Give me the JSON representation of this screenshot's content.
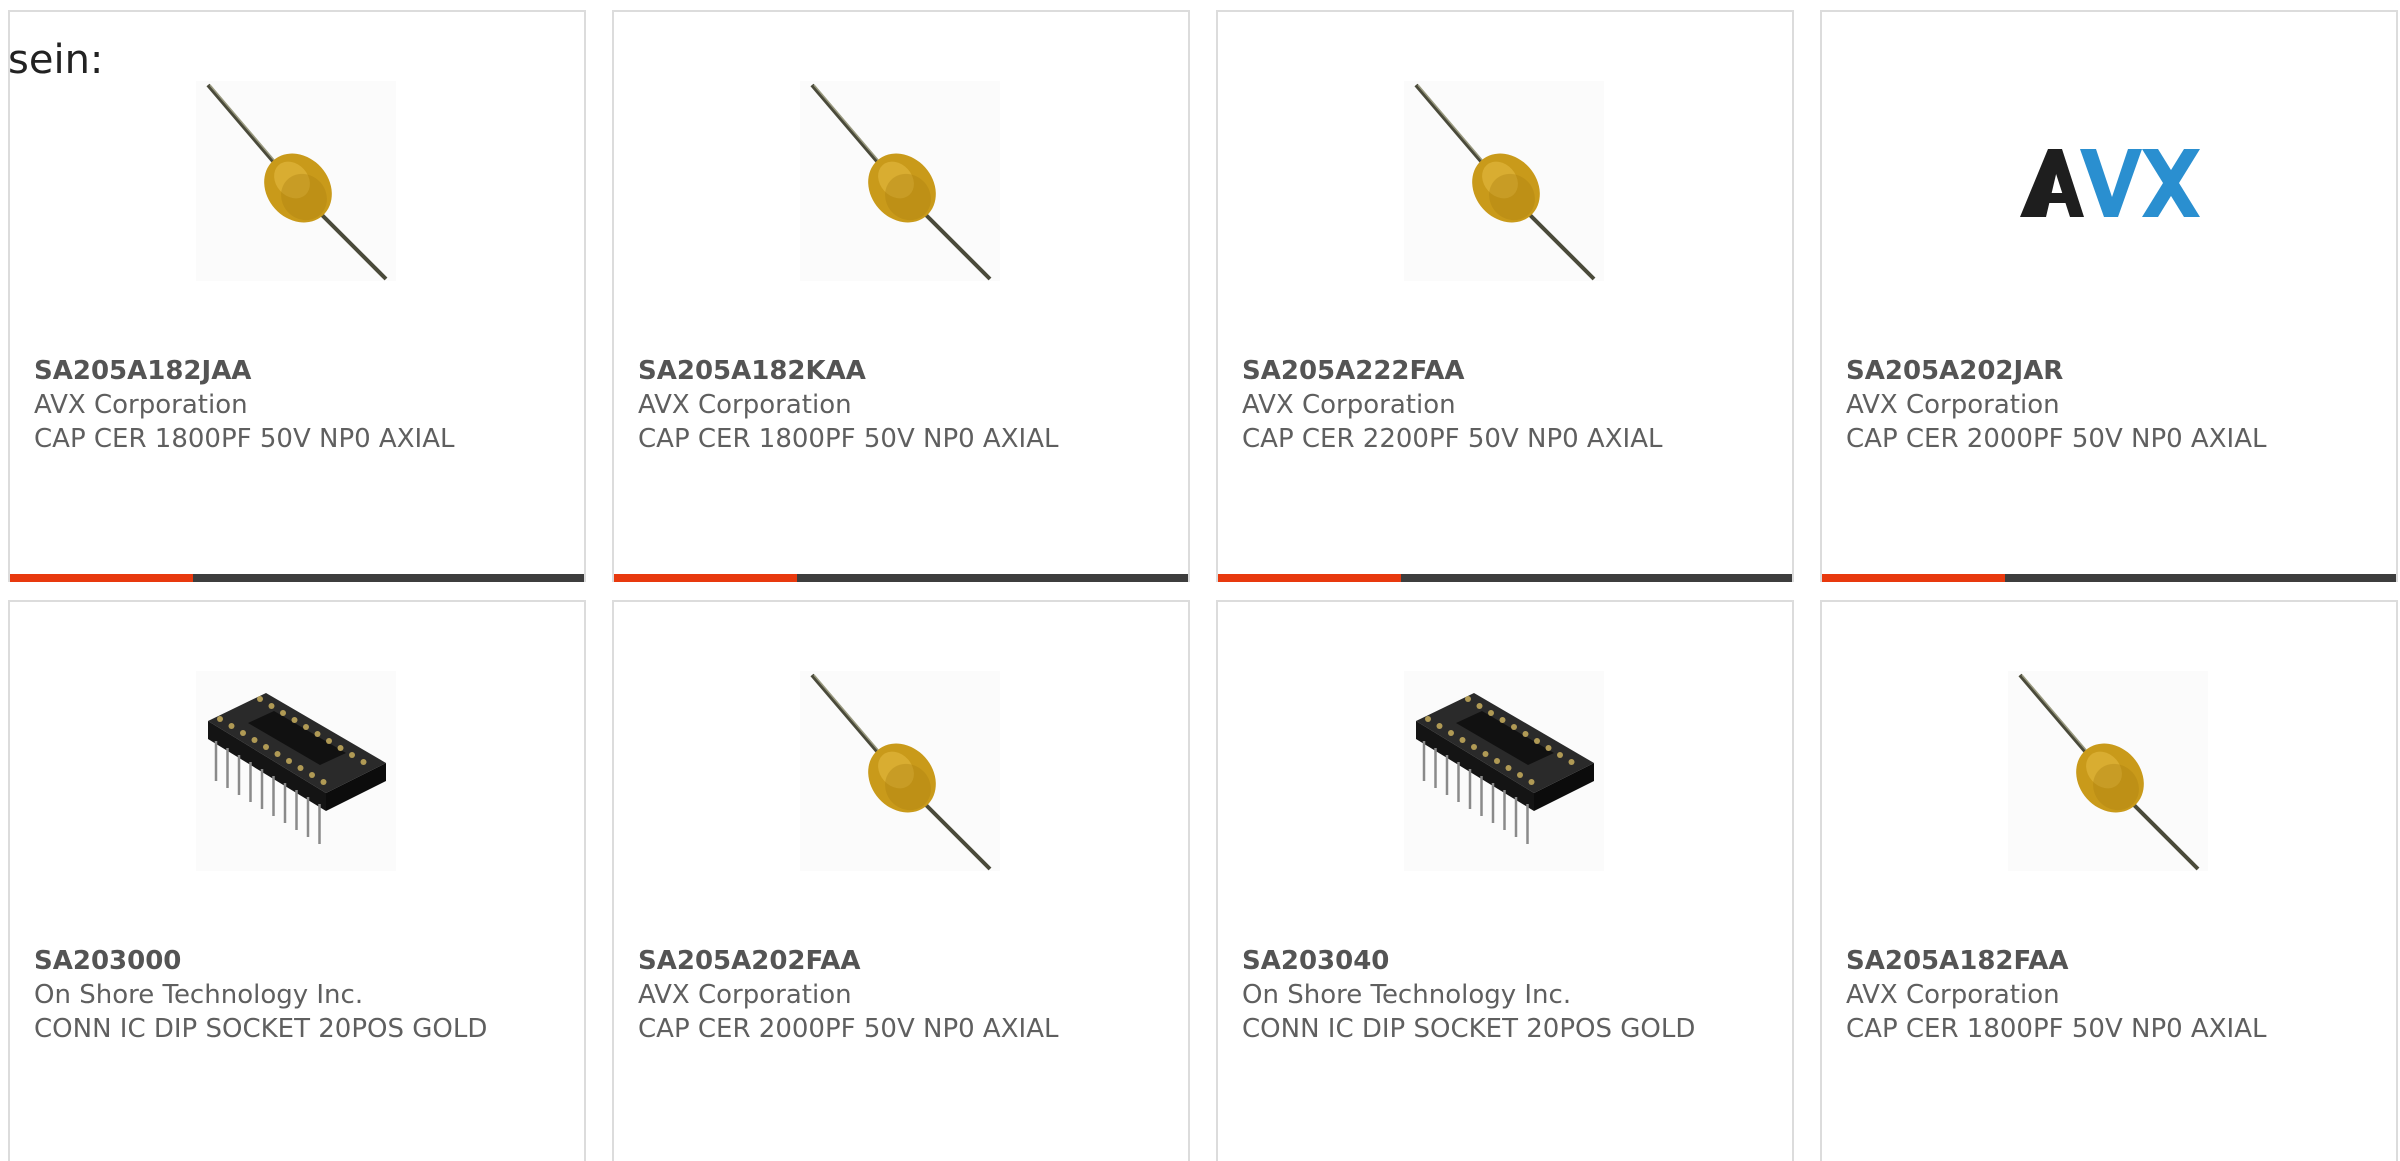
{
  "intro_text": "sein:",
  "colors": {
    "accent": "#e8390e",
    "bar": "#3d3d3d",
    "border": "#dcdcdc",
    "text": "#5f5f5f"
  },
  "products": [
    {
      "part_number": "SA205A182JAA",
      "manufacturer": "AVX Corporation",
      "description": "CAP CER 1800PF 50V NP0 AXIAL",
      "image": "axial-capacitor-icon"
    },
    {
      "part_number": "SA205A182KAA",
      "manufacturer": "AVX Corporation",
      "description": "CAP CER 1800PF 50V NP0 AXIAL",
      "image": "axial-capacitor-icon"
    },
    {
      "part_number": "SA205A222FAA",
      "manufacturer": "AVX Corporation",
      "description": "CAP CER 2200PF 50V NP0 AXIAL",
      "image": "axial-capacitor-icon"
    },
    {
      "part_number": "SA205A202JAR",
      "manufacturer": "AVX Corporation",
      "description": "CAP CER 2000PF 50V NP0 AXIAL",
      "image": "avx-logo",
      "logo_text": "AVX"
    },
    {
      "part_number": "SA203000",
      "manufacturer": "On Shore Technology Inc.",
      "description": "CONN IC DIP SOCKET 20POS GOLD",
      "image": "dip-socket-icon"
    },
    {
      "part_number": "SA205A202FAA",
      "manufacturer": "AVX Corporation",
      "description": "CAP CER 2000PF 50V NP0 AXIAL",
      "image": "axial-capacitor-icon"
    },
    {
      "part_number": "SA203040",
      "manufacturer": "On Shore Technology Inc.",
      "description": "CONN IC DIP SOCKET 20POS GOLD",
      "image": "dip-socket-icon"
    },
    {
      "part_number": "SA205A182FAA",
      "manufacturer": "AVX Corporation",
      "description": "CAP CER 1800PF 50V NP0 AXIAL",
      "image": "axial-capacitor-icon"
    }
  ]
}
